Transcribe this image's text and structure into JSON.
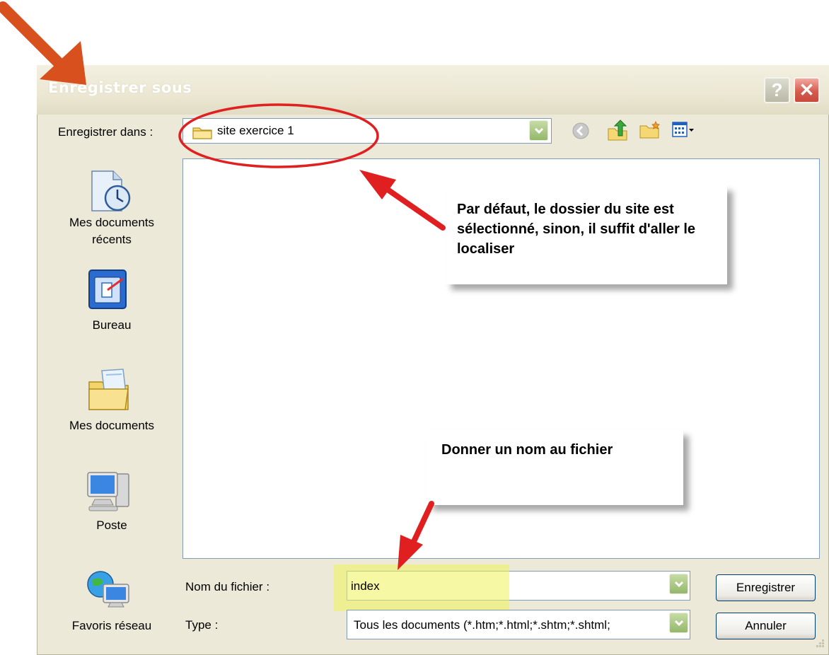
{
  "dialog": {
    "title": "Enregistrer sous",
    "help_label": "?",
    "close_label": "✕",
    "save_in_label": "Enregistrer dans :",
    "save_in_value": "site exercice 1"
  },
  "places": [
    {
      "label": "Mes documents récents",
      "icon": "recent-documents-icon"
    },
    {
      "label": "Bureau",
      "icon": "desktop-icon"
    },
    {
      "label": "Mes documents",
      "icon": "my-documents-icon"
    },
    {
      "label": "Poste",
      "icon": "computer-icon"
    },
    {
      "label": "Favoris réseau",
      "icon": "network-icon"
    }
  ],
  "fields": {
    "filename_label": "Nom du fichier :",
    "filename_value": "index",
    "type_label": "Type :",
    "type_value": "Tous les documents (*.htm;*.html;*.shtm;*.shtml;"
  },
  "buttons": {
    "save": "Enregistrer",
    "cancel": "Annuler"
  },
  "annotations": {
    "folder_note": "Par défaut, le dossier du site est sélectionné, sinon, il suffit d'aller le localiser",
    "filename_note": "Donner un nom au fichier"
  },
  "colors": {
    "dialog_bg": "#ece9d8",
    "annotation_red": "#e02020",
    "corner_arrow": "#d8501e",
    "highlight": "#f0f25a"
  }
}
